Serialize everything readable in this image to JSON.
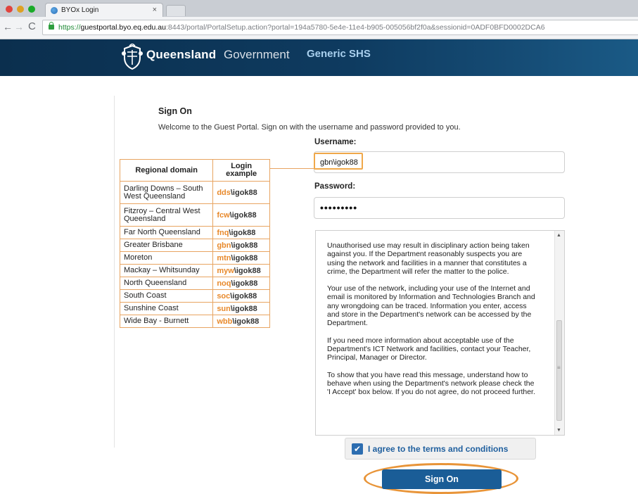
{
  "browser": {
    "tab_title": "BYOx Login",
    "tab_close": "×",
    "url_https": "https://",
    "url_host": "guestportal.byo.eq.edu.au",
    "url_rest": ":8443/portal/PortalSetup.action?portal=194a5780-5e4e-11e4-b905-005056bf2f0a&sessionid=0ADF0BFD0002DCA6",
    "nav": {
      "back": "←",
      "forward": "→",
      "reload": "C"
    }
  },
  "header": {
    "brand_bold": "Queensland",
    "brand_light": "Government",
    "subtitle": "Generic SHS"
  },
  "page": {
    "title": "Sign On",
    "welcome": "Welcome to the Guest Portal. Sign on with the username and password provided to you."
  },
  "domain_table": {
    "headers": [
      "Regional domain",
      "Login example"
    ],
    "rows": [
      {
        "region": "Darling Downs – South West Queensland",
        "prefix": "dds",
        "suffix": "\\igok88"
      },
      {
        "region": "Fitzroy – Central West Queensland",
        "prefix": "fcw",
        "suffix": "\\igok88"
      },
      {
        "region": "Far North Queensland",
        "prefix": "fnq",
        "suffix": "\\igok88"
      },
      {
        "region": "Greater Brisbane",
        "prefix": "gbn",
        "suffix": "\\igok88"
      },
      {
        "region": "Moreton",
        "prefix": "mtn",
        "suffix": "\\igok88"
      },
      {
        "region": "Mackay – Whitsunday",
        "prefix": "myw",
        "suffix": "\\igok88"
      },
      {
        "region": "North Queensland",
        "prefix": "noq",
        "suffix": "\\igok88"
      },
      {
        "region": "South Coast",
        "prefix": "soc",
        "suffix": "\\igok88"
      },
      {
        "region": "Sunshine Coast",
        "prefix": "sun",
        "suffix": "\\igok88"
      },
      {
        "region": "Wide Bay - Burnett",
        "prefix": "wbb",
        "suffix": "\\igok88"
      }
    ]
  },
  "form": {
    "username_label": "Username:",
    "username_value": "gbn\\igok88",
    "password_label": "Password:",
    "password_value": "•••••••••"
  },
  "terms": {
    "paragraphs": [
      "Unauthorised use may result in disciplinary action being taken against you. If the Department reasonably suspects you are using the network and facilities in a manner that constitutes a crime, the Department will refer the matter to the police.",
      "Your use of the network, including your use of the Internet and email is monitored by Information and Technologies Branch and any wrongdoing can be traced. Information you enter, access and store in the Department's network can be accessed by the Department.",
      "If you need more information about acceptable use of the Department's ICT Network and facilities, contact your Teacher, Principal, Manager or Director.",
      "To show that you have read this message, understand how to behave when using the Department's network please check the 'I Accept' box below. If you do not agree, do not proceed further."
    ]
  },
  "agree": {
    "checked": true,
    "check_glyph": "✔",
    "label": "I agree to the terms and conditions"
  },
  "signon_button": "Sign On",
  "colors": {
    "header_bg": "#0e3b60",
    "accent_orange": "#e8892b",
    "button_blue": "#1a5d97",
    "agree_text": "#1f5f9e"
  }
}
